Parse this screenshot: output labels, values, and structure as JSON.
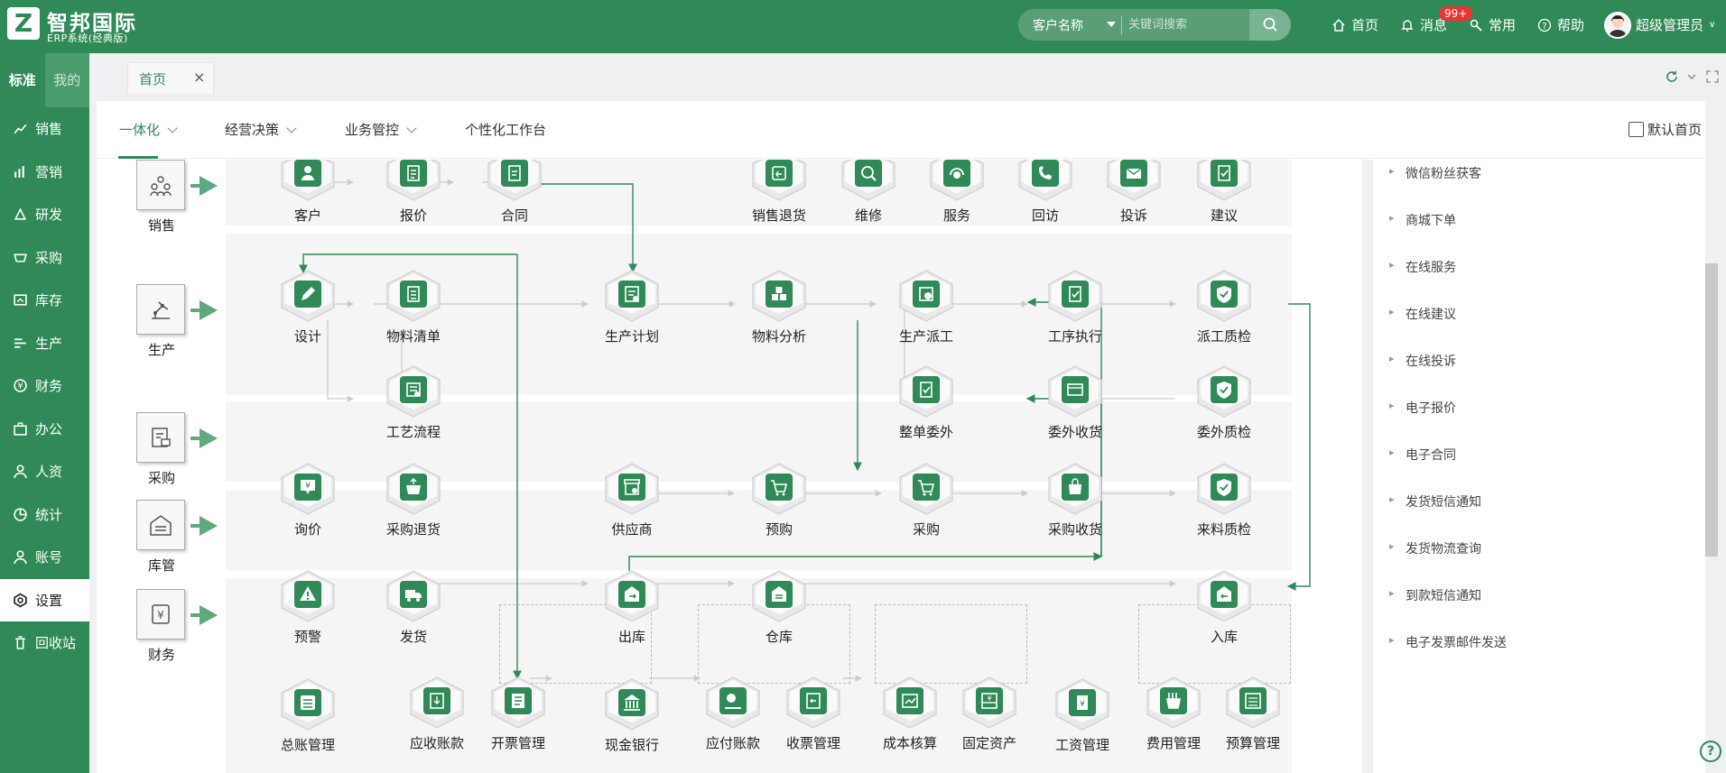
{
  "brand": {
    "mark": "Z",
    "title": "智邦国际",
    "subtitle": "ERP系统(经典版)"
  },
  "search": {
    "type": "客户名称",
    "placeholder": "关键词搜索"
  },
  "topnav": {
    "home": "首页",
    "messages": "消息",
    "badge": "99+",
    "common": "常用",
    "help": "帮助",
    "user": "超级管理员"
  },
  "sidebar": {
    "tabs": [
      "标准",
      "我的"
    ],
    "items": [
      "销售",
      "营销",
      "研发",
      "采购",
      "库存",
      "生产",
      "财务",
      "办公",
      "人资",
      "统计",
      "账号",
      "设置",
      "回收站"
    ],
    "active": "设置"
  },
  "page_tabs": [
    {
      "label": "首页",
      "close": "×"
    }
  ],
  "nav_tabs": [
    "一体化",
    "经营决策",
    "业务管控",
    "个性化工作台"
  ],
  "default_home_label": "默认首页",
  "departments": [
    "销售",
    "生产",
    "采购",
    "库管",
    "财务"
  ],
  "nodes": {
    "kehu": "客户",
    "baojia": "报价",
    "hetong": "合同",
    "xiaoshoutuihuo": "销售退货",
    "weixiu": "维修",
    "fuwu": "服务",
    "huifang": "回访",
    "tousu": "投诉",
    "jianyi": "建议",
    "sheji": "设计",
    "wuliaoqingdan": "物料清单",
    "shengchanjihua": "生产计划",
    "wuliaofenxi": "物料分析",
    "shengchanpaigong": "生产派工",
    "gongxuzhixing": "工序执行",
    "paigongzhijian": "派工质检",
    "gongyiliucheng": "工艺流程",
    "zhengdanweiwai": "整单委外",
    "weiwaishouhuo": "委外收货",
    "weiwaizhijian": "委外质检",
    "xunjia": "询价",
    "caigoutuihuo": "采购退货",
    "gongyingshang": "供应商",
    "yugou": "预购",
    "caigou": "采购",
    "caigoushouhuo": "采购收货",
    "lailiaozhijian": "来料质检",
    "yujing": "预警",
    "fahuo": "发货",
    "chuku": "出库",
    "cangku": "仓库",
    "ruku": "入库",
    "zongzhang": "总账管理",
    "yingshou": "应收账款",
    "kaipiao": "开票管理",
    "xianjin": "现金银行",
    "yingfu": "应付账款",
    "shoupiao": "收票管理",
    "chengben": "成本核算",
    "guding": "固定资产",
    "gongzi": "工资管理",
    "feiyong": "费用管理",
    "yusuan": "预算管理"
  },
  "right_panel": [
    "微信粉丝获客",
    "商城下单",
    "在线服务",
    "在线建议",
    "在线投诉",
    "电子报价",
    "电子合同",
    "发货短信通知",
    "发货物流查询",
    "到款短信通知",
    "电子发票邮件发送"
  ],
  "help_float": "?",
  "colors": {
    "brand": "#2f8a57",
    "icon": "#2f8a57"
  }
}
